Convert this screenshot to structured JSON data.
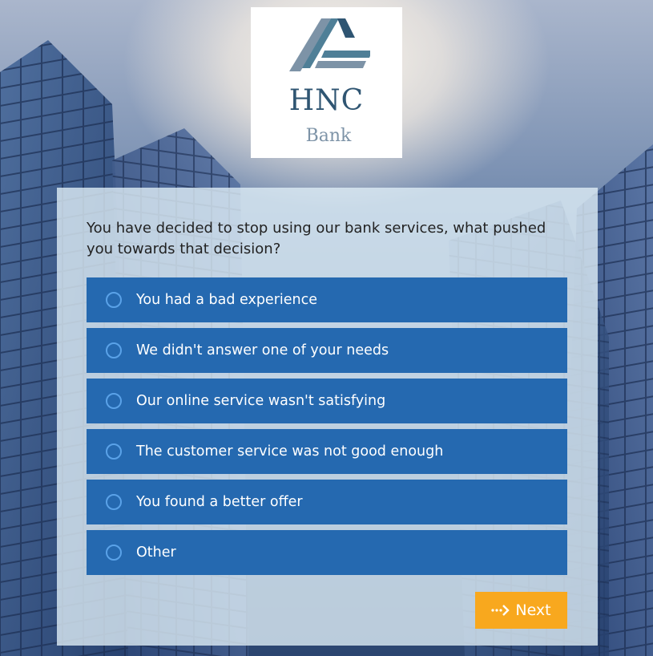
{
  "brand": {
    "name": "HNC",
    "sub": "Bank",
    "colors": {
      "primary": "#2f5572",
      "secondary": "#7d93a7",
      "accent": "#4f7f97"
    }
  },
  "survey": {
    "question": "You have decided to stop using our bank services, what pushed you towards that decision?",
    "options": [
      {
        "label": "You had a bad experience"
      },
      {
        "label": "We didn't answer one of your needs"
      },
      {
        "label": "Our online service wasn't satisfying"
      },
      {
        "label": "The customer service was not good enough"
      },
      {
        "label": "You found a better offer"
      },
      {
        "label": "Other"
      }
    ],
    "next_label": "Next",
    "option_color": "#2569b0",
    "button_color": "#f8a81e"
  },
  "icons": {
    "logo": "hnc-triangle-logo-icon",
    "radio": "radio-circle-icon",
    "next": "dotted-arrow-right-icon"
  }
}
